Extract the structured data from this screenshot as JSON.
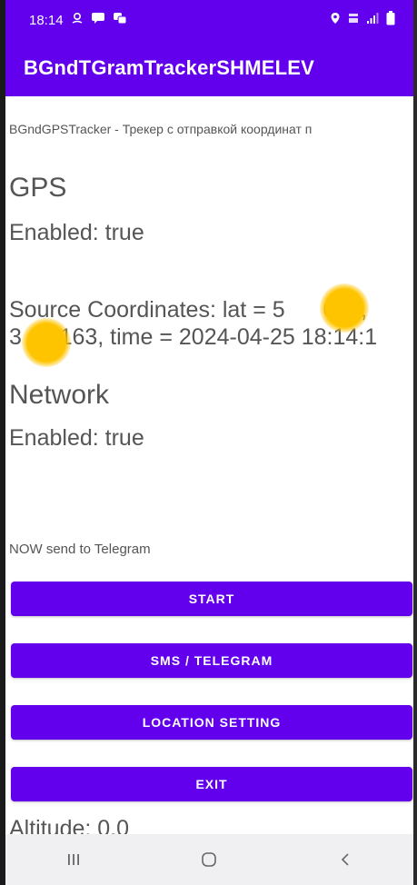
{
  "status_bar": {
    "time": "18:14",
    "left_icons": [
      "location-pin-icon",
      "message-icon",
      "chat-icon"
    ],
    "right_icons": [
      "location-icon",
      "signal-4g-icon",
      "cell-signal-icon",
      "battery-icon"
    ]
  },
  "app_bar": {
    "title": "BGndTGramTrackerSHMELEV",
    "color": "#6200ee"
  },
  "main": {
    "subtitle": "BGndGPSTracker - Трекер с отправкой координат п",
    "gps": {
      "title": "GPS",
      "enabled": "Enabled: true",
      "coordinates_line1": "Source Coordinates: lat = 5      622,",
      "coordinates_line2": "3      163, time = 2024-04-25 18:14:1"
    },
    "network": {
      "title": "Network",
      "enabled": "Enabled: true"
    },
    "status_text": "NOW send to Telegram",
    "buttons": {
      "start": "START",
      "sms_telegram": "SMS / TELEGRAM",
      "location_setting": "LOCATION SETTING",
      "exit": "EXIT"
    },
    "altitude": "Altitude: 0.0"
  },
  "nav_bar": {
    "icons": [
      "recent-apps-icon",
      "home-icon",
      "back-icon"
    ]
  }
}
